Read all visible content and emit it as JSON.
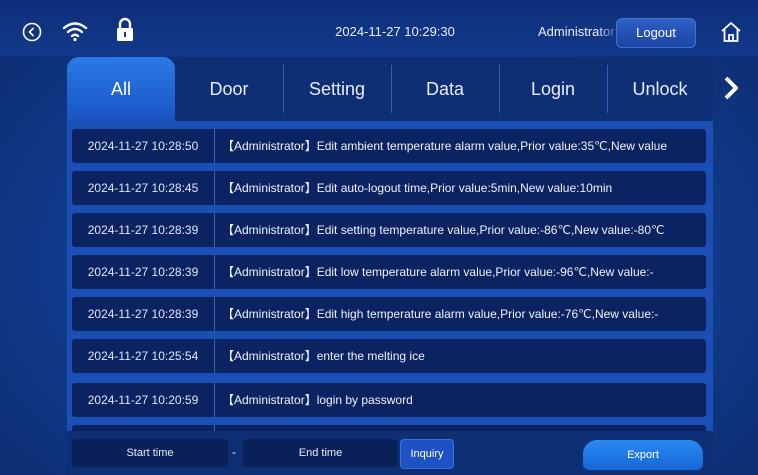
{
  "status_bar": {
    "datetime": "2024-11-27 10:29:30",
    "user": "Administrator",
    "logout_label": "Logout"
  },
  "tabs": [
    {
      "label": "All",
      "active": true
    },
    {
      "label": "Door",
      "active": false
    },
    {
      "label": "Setting",
      "active": false
    },
    {
      "label": "Data",
      "active": false
    },
    {
      "label": "Login",
      "active": false
    },
    {
      "label": "Unlock",
      "active": false
    }
  ],
  "log_rows": [
    {
      "time": "2024-11-27 10:28:50",
      "text": "【Administrator】Edit ambient temperature alarm value,Prior value:35℃,New value"
    },
    {
      "time": "2024-11-27 10:28:45",
      "text": "【Administrator】Edit auto-logout time,Prior value:5min,New value:10min"
    },
    {
      "time": "2024-11-27 10:28:39",
      "text": "【Administrator】Edit setting temperature value,Prior value:-86℃,New value:-80℃"
    },
    {
      "time": "2024-11-27 10:28:39",
      "text": "【Administrator】Edit low temperature alarm value,Prior value:-96℃,New value:-"
    },
    {
      "time": "2024-11-27 10:28:39",
      "text": "【Administrator】Edit high temperature alarm value,Prior value:-76℃,New value:-"
    },
    {
      "time": "2024-11-27 10:25:54",
      "text": "【Administrator】enter the melting ice"
    },
    {
      "time": "2024-11-27 10:20:59",
      "text": "【Administrator】login by password"
    }
  ],
  "filters": {
    "start_time_label": "Start time",
    "dash": "-",
    "end_time_label": "End time",
    "inquiry_label": "Inquiry",
    "export_label": "Export"
  },
  "icons": {
    "back": "back-circle-icon",
    "wifi": "wifi-icon",
    "lock": "lock-icon",
    "home": "home-icon",
    "next": "chevron-right-icon"
  }
}
